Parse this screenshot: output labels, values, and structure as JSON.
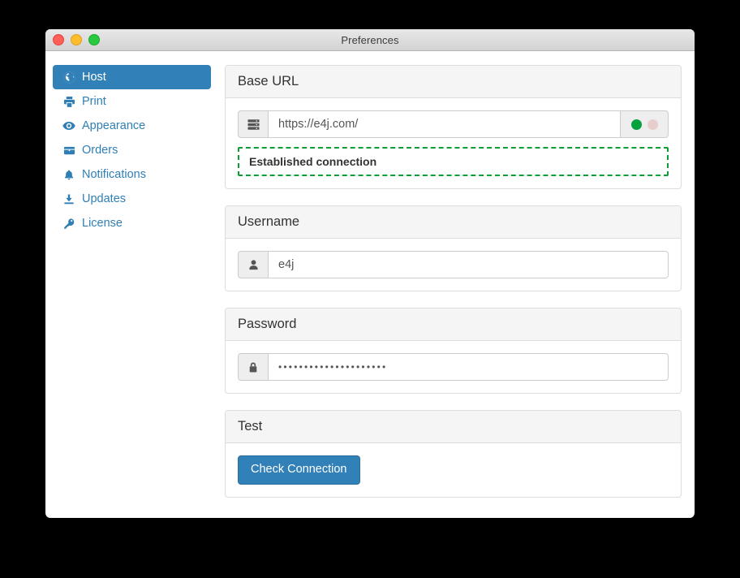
{
  "window": {
    "title": "Preferences",
    "controls": {
      "close": "close",
      "minimize": "minimize",
      "maximize": "maximize"
    }
  },
  "sidebar": {
    "items": [
      {
        "label": "Host",
        "icon": "globe-icon",
        "active": true
      },
      {
        "label": "Print",
        "icon": "printer-icon",
        "active": false
      },
      {
        "label": "Appearance",
        "icon": "eye-icon",
        "active": false
      },
      {
        "label": "Orders",
        "icon": "box-icon",
        "active": false
      },
      {
        "label": "Notifications",
        "icon": "bell-icon",
        "active": false
      },
      {
        "label": "Updates",
        "icon": "download-icon",
        "active": false
      },
      {
        "label": "License",
        "icon": "key-icon",
        "active": false
      }
    ]
  },
  "panels": {
    "base_url": {
      "title": "Base URL",
      "addon_icon": "server-icon",
      "value": "https://e4j.com/",
      "placeholder": "https://e4j.com/",
      "status_dots": [
        {
          "name": "status-dot-connected",
          "color": "#04a23e"
        },
        {
          "name": "status-dot-idle",
          "color": "#e8cdcd"
        }
      ],
      "alert": "Established connection",
      "alert_border_color": "#0a9e34"
    },
    "username": {
      "title": "Username",
      "addon_icon": "user-icon",
      "value": "e4j",
      "placeholder": "Username"
    },
    "password": {
      "title": "Password",
      "addon_icon": "lock-icon",
      "value": "•••••••••••••••••••••",
      "placeholder": "Password"
    },
    "test": {
      "title": "Test",
      "button_label": "Check Connection"
    }
  },
  "colors": {
    "accent": "#3180b8",
    "success": "#0a9e34",
    "panel_header": "#f5f5f5"
  }
}
